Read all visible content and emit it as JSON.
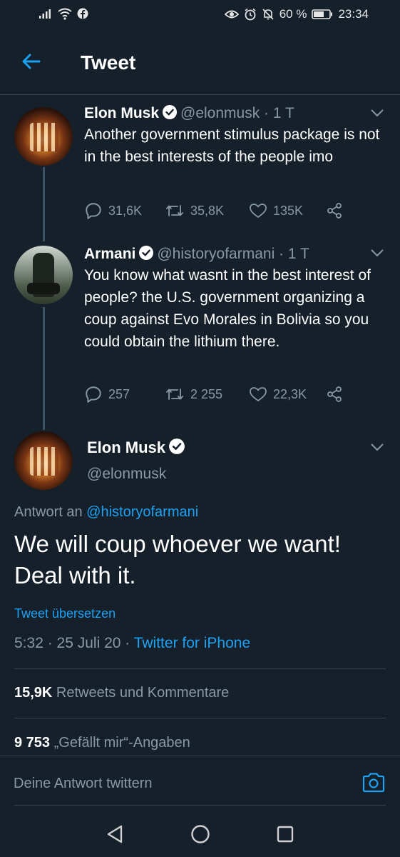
{
  "status_bar": {
    "battery": "60 %",
    "time": "23:34"
  },
  "header": {
    "title": "Tweet"
  },
  "thread": [
    {
      "name": "Elon Musk",
      "handle": "@elonmusk",
      "time": "1 T",
      "text": "Another government stimulus package is not in the best interests of the people imo",
      "replies": "31,6K",
      "retweets": "35,8K",
      "likes": "135K"
    },
    {
      "name": "Armani",
      "handle": "@historyofarmani",
      "time": "1 T",
      "text": "You know what wasnt in the best interest of people? the U.S. government organizing a coup against Evo Morales in Bolivia so you could obtain the lithium there.",
      "replies": "257",
      "retweets": "2 255",
      "likes": "22,3K"
    }
  ],
  "main_tweet": {
    "name": "Elon Musk",
    "handle": "@elonmusk",
    "reply_prefix": "Antwort an ",
    "reply_to": "@historyofarmani",
    "text": "We will coup whoever we want! Deal with it.",
    "translate": "Tweet übersetzen",
    "timestamp": "5:32 · 25 Juli 20 · ",
    "source": "Twitter for iPhone",
    "retweets_count": "15,9K",
    "retweets_label": " Retweets und Kommentare",
    "likes_count": "9 753",
    "likes_label": " „Gefällt mir“-Angaben"
  },
  "reply_box": {
    "placeholder": "Deine Antwort twittern"
  },
  "colors": {
    "background": "#15202b",
    "accent": "#1da1f2",
    "muted": "#8899a6",
    "divider": "#38444d"
  }
}
